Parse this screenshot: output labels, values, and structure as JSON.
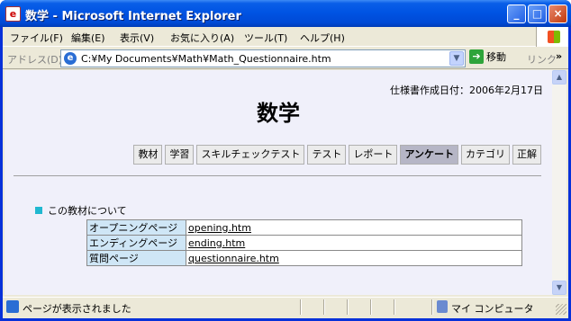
{
  "window": {
    "title": "数学 - Microsoft Internet Explorer",
    "app_icon_glyph": "e",
    "buttons": {
      "min": "_",
      "max": "□",
      "close": "×"
    }
  },
  "menu": [
    "ファイル(F)",
    "編集(E)",
    "表示(V)",
    "お気に入り(A)",
    "ツール(T)",
    "ヘルプ(H)"
  ],
  "address": {
    "label": "アドレス(D)",
    "url": "C:¥My Documents¥Math¥Math_Questionnaire.htm",
    "go_label": "移動",
    "links_label": "リンク",
    "chevron": "»"
  },
  "page": {
    "spec_date": "仕様書作成日付：2006年2月17日",
    "title": "数学",
    "tabs": [
      {
        "label": "教材",
        "active": false
      },
      {
        "label": "学習",
        "active": false
      },
      {
        "label": "スキルチェックテスト",
        "active": false
      },
      {
        "label": "テスト",
        "active": false
      },
      {
        "label": "レポート",
        "active": false
      },
      {
        "label": "アンケート",
        "active": true
      },
      {
        "label": "カテゴリ",
        "active": false
      },
      {
        "label": "正解",
        "active": false
      }
    ],
    "section_heading": "この教材について",
    "rows": [
      {
        "key": "オープニングページ",
        "value": "opening.htm"
      },
      {
        "key": "エンディングページ",
        "value": "ending.htm"
      },
      {
        "key": "質問ページ",
        "value": "questionnaire.htm"
      }
    ]
  },
  "status": {
    "text": "ページが表示されました",
    "zone": "マイ コンピュータ"
  },
  "colors": {
    "titlebar": "#0054e3",
    "content_bg": "#f0f0fa",
    "active_tab": "#b6b6c6",
    "bullet": "#20b8d0",
    "key_cell": "#cfe6f6"
  }
}
